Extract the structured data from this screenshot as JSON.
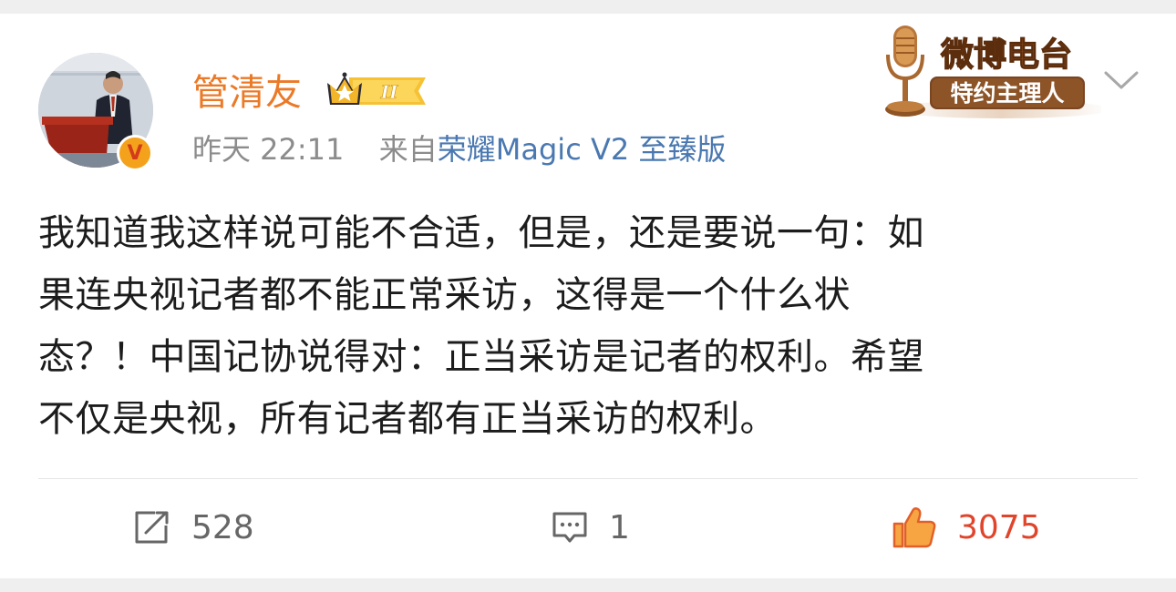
{
  "post": {
    "author": {
      "name": "管清友",
      "avatar_icon": "person-at-podium-photo",
      "verified_icon": "orange-v-verified",
      "verified_letter": "V",
      "vip_badge_text": "II",
      "vip_icon": "crown-icon"
    },
    "badge": {
      "title": "微博电台",
      "subtitle": "特约主理人",
      "icon": "microphone-icon"
    },
    "meta": {
      "time": "昨天 22:11",
      "source_prefix": "来自",
      "source_device": "荣耀Magic V2 至臻版"
    },
    "content": {
      "lines": [
        "我知道我这样说可能不合适，但是，还是要说一句：如",
        "果连央视记者都不能正常采访，这得是一个什么状",
        "态？！中国记协说得对：正当采访是记者的权利。希望",
        "不仅是央视，所有记者都有正当采访的权利。"
      ]
    },
    "actions": {
      "repost_count": "528",
      "comment_count": "1",
      "like_count": "3075"
    }
  },
  "colors": {
    "username": "#eb7a28",
    "source_link": "#4a78b0",
    "like": "#e8542c",
    "muted": "#8c8c8c"
  }
}
